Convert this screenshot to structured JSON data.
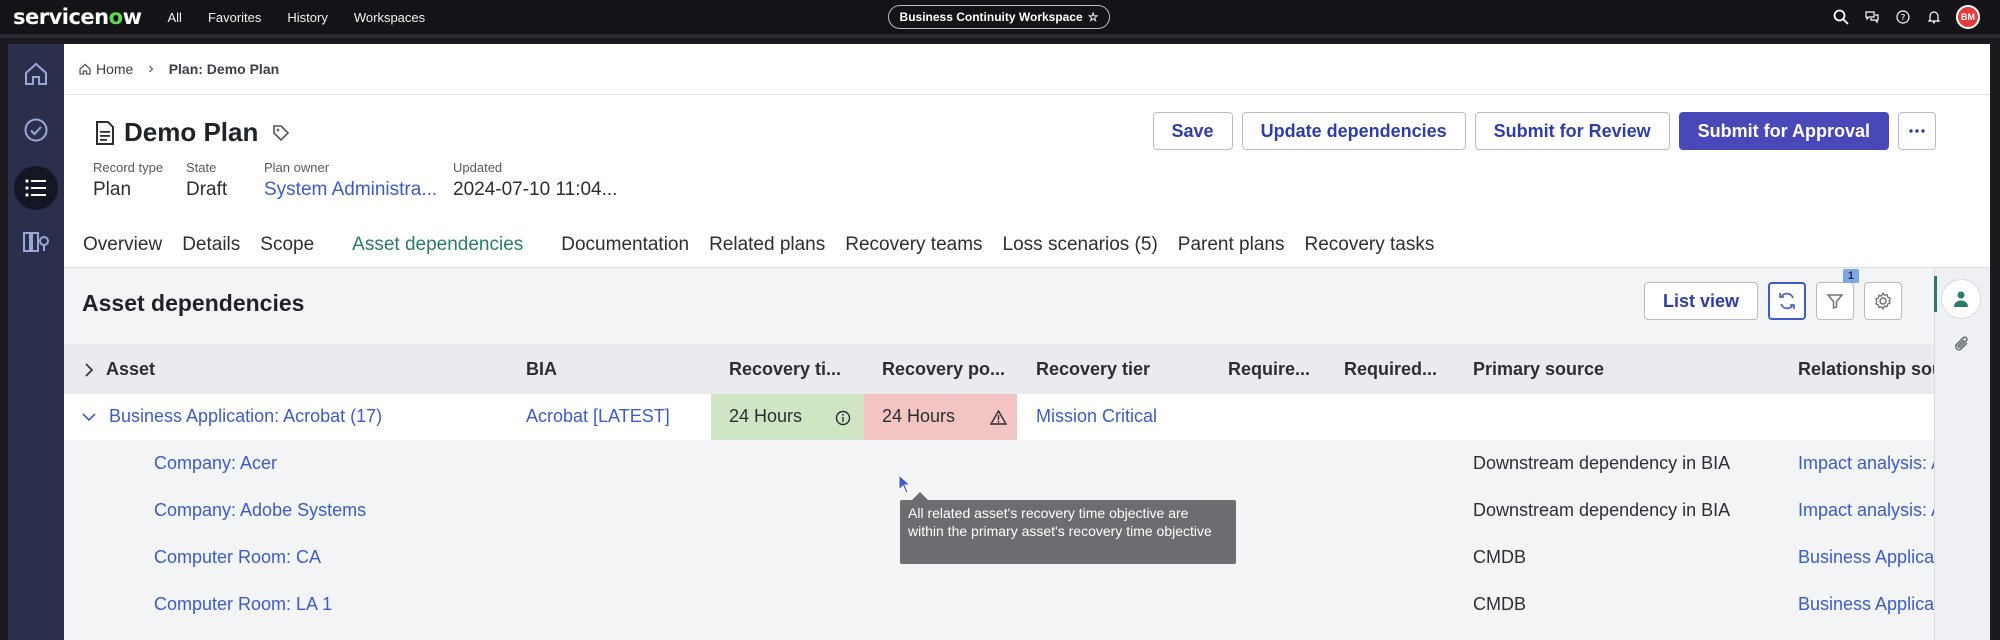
{
  "topbar": {
    "logo_prefix": "servicen",
    "logo_o": "o",
    "logo_suffix": "w",
    "nav": [
      "All",
      "Favorites",
      "History",
      "Workspaces"
    ],
    "workspace": "Business Continuity Workspace",
    "avatar": "BM"
  },
  "breadcrumb": {
    "home": "Home",
    "current": "Plan: Demo Plan"
  },
  "record": {
    "title": "Demo Plan",
    "fields": [
      {
        "label": "Record type",
        "value": "Plan"
      },
      {
        "label": "State",
        "value": "Draft"
      },
      {
        "label": "Plan owner",
        "value": "System Administra..."
      },
      {
        "label": "Updated",
        "value": "2024-07-10 11:04..."
      }
    ]
  },
  "actions": {
    "save": "Save",
    "update_dependencies": "Update dependencies",
    "submit_review": "Submit for Review",
    "submit_approval": "Submit for Approval"
  },
  "tabs": [
    "Overview",
    "Details",
    "Scope",
    "Asset dependencies",
    "Documentation",
    "Related plans",
    "Recovery teams",
    "Loss scenarios (5)",
    "Parent plans",
    "Recovery tasks"
  ],
  "active_tab": "Asset dependencies",
  "panel": {
    "title": "Asset dependencies",
    "list_view": "List view",
    "filter_badge": "1"
  },
  "columns": [
    "Asset",
    "BIA",
    "Recovery ti...",
    "Recovery po...",
    "Recovery tier",
    "Require...",
    "Required...",
    "Primary source",
    "Relationship sou"
  ],
  "group_row": {
    "asset": "Business Application: Acrobat (17)",
    "bia": "Acrobat [LATEST]",
    "rto": "24 Hours",
    "rpo": "24 Hours",
    "tier": "Mission Critical"
  },
  "rows": [
    {
      "asset": "Company: Acer",
      "source": "Downstream dependency in BIA",
      "relationship": "Impact analysis: A"
    },
    {
      "asset": "Company: Adobe Systems",
      "source": "Downstream dependency in BIA",
      "relationship": "Impact analysis: A"
    },
    {
      "asset": "Computer Room: CA",
      "source": "CMDB",
      "relationship": "Business Applica"
    },
    {
      "asset": "Computer Room: LA 1",
      "source": "CMDB",
      "relationship": "Business Applica"
    }
  ],
  "tooltip": "All related asset's recovery time objective are within the primary asset's recovery time objective",
  "colors": {
    "accent_green": "#2a7a6e",
    "primary_button": "#4a47b8",
    "link": "#3c5bc9",
    "rto_bg": "#cfe5c3",
    "rpo_bg": "#f2c4c2"
  }
}
